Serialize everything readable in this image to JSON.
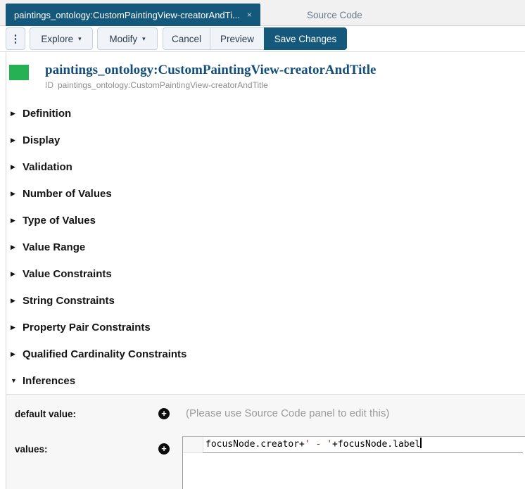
{
  "colors": {
    "accent_teal": "#14587c",
    "resource_icon_green": "#25b154",
    "code_string_red": "#a31515",
    "panel_gray": "#f7f7f7"
  },
  "icons": {
    "close": "×",
    "kebab": "⋮",
    "caret_down": "▾",
    "collapse_right": "▶",
    "collapse_down": "▼",
    "plus": "+"
  },
  "tabs": {
    "active": {
      "label": "paintings_ontology:CustomPaintingView-creatorAndTi..."
    },
    "source_code": {
      "label": "Source Code"
    }
  },
  "toolbar": {
    "explore": "Explore",
    "modify": "Modify",
    "cancel": "Cancel",
    "preview": "Preview",
    "save": "Save Changes"
  },
  "header": {
    "title": "paintings_ontology:CustomPaintingView-creatorAndTitle",
    "id_label": "ID",
    "id_value": "paintings_ontology:CustomPaintingView-creatorAndTitle"
  },
  "sections": {
    "items": [
      {
        "label": "Definition",
        "expanded": false
      },
      {
        "label": "Display",
        "expanded": false
      },
      {
        "label": "Validation",
        "expanded": false
      },
      {
        "label": "Number of Values",
        "expanded": false
      },
      {
        "label": "Type of Values",
        "expanded": false
      },
      {
        "label": "Value Range",
        "expanded": false
      },
      {
        "label": "Value Constraints",
        "expanded": false
      },
      {
        "label": "String Constraints",
        "expanded": false
      },
      {
        "label": "Property Pair Constraints",
        "expanded": false
      },
      {
        "label": "Qualified Cardinality Constraints",
        "expanded": false
      },
      {
        "label": "Inferences",
        "expanded": true
      }
    ]
  },
  "inferences": {
    "default_row": {
      "label": "default value:",
      "note": "(Please use Source Code panel to edit this)"
    },
    "values_row": {
      "label": "values:"
    },
    "code": {
      "part1": "focusNode.creator+",
      "string": "' - '",
      "part2": "+focusNode.label"
    }
  }
}
